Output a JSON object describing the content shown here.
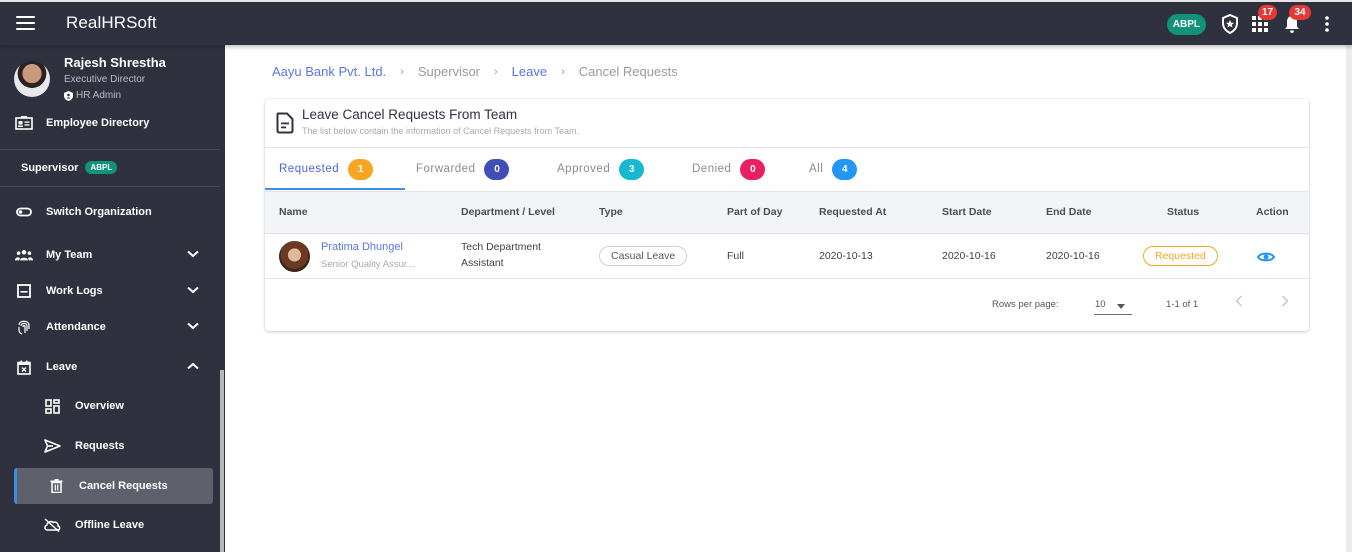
{
  "topbar": {
    "app_title": "RealHRSoft",
    "org_chip": "ABPL",
    "icons": [
      "menu-icon",
      "shield-star-icon",
      "apps-grid-icon",
      "bell-icon",
      "more-vert-icon"
    ],
    "apps_badge": "17",
    "notifications_badge": "34"
  },
  "sidebar": {
    "profile": {
      "name": "Rajesh Shrestha",
      "role": "Executive Director",
      "admin": "HR Admin"
    },
    "employee_directory": "Employee Directory",
    "section": {
      "label": "Supervisor",
      "chip": "ABPL"
    },
    "items": [
      {
        "label": "Switch Organization",
        "icon": "toggle-icon"
      },
      {
        "label": "My Team",
        "icon": "group-icon",
        "expand": "chevron-down"
      },
      {
        "label": "Work Logs",
        "icon": "worklog-icon",
        "expand": "chevron-down"
      },
      {
        "label": "Attendance",
        "icon": "fingerprint-icon",
        "expand": "chevron-down"
      },
      {
        "label": "Leave",
        "icon": "calendar-x-icon",
        "expand": "chevron-up"
      }
    ],
    "leave_sub": [
      {
        "label": "Overview",
        "icon": "dashboard-icon"
      },
      {
        "label": "Requests",
        "icon": "send-icon"
      },
      {
        "label": "Cancel Requests",
        "icon": "trash-icon",
        "active": true
      },
      {
        "label": "Offline Leave",
        "icon": "cloud-off-icon"
      }
    ]
  },
  "breadcrumb": {
    "items": [
      "Aayu Bank Pvt. Ltd.",
      "Supervisor",
      "Leave",
      "Cancel Requests"
    ],
    "separator": "›"
  },
  "card": {
    "title": "Leave Cancel Requests From Team",
    "subtitle": "The list below contain the information of Cancel Requests from Team.",
    "tabs": [
      {
        "label": "Requested",
        "count": "1",
        "color": "#f5a623",
        "active": true
      },
      {
        "label": "Forwarded",
        "count": "0",
        "color": "#3f4fb5"
      },
      {
        "label": "Approved",
        "count": "3",
        "color": "#17b9d0"
      },
      {
        "label": "Denied",
        "count": "0",
        "color": "#e91e63"
      },
      {
        "label": "All",
        "count": "4",
        "color": "#2196f3"
      }
    ],
    "columns": [
      "Name",
      "Department / Level",
      "Type",
      "Part of Day",
      "Requested At",
      "Start Date",
      "End Date",
      "Status",
      "Action"
    ],
    "rows": [
      {
        "name": "Pratima Dhungel",
        "title": "Senior Quality Assur...",
        "department": "Tech Department",
        "level": "Assistant",
        "type": "Casual Leave",
        "part_of_day": "Full",
        "requested_at": "2020-10-13",
        "start_date": "2020-10-16",
        "end_date": "2020-10-16",
        "status": "Requested",
        "status_color": "#f5a623",
        "action_icon": "eye-icon"
      }
    ],
    "pagination": {
      "rows_per_page_label": "Rows per page:",
      "rows_per_page": "10",
      "range": "1-1 of 1"
    }
  },
  "colors": {
    "sidebar_bg": "#30313f",
    "accent": "#3c8fe6",
    "link": "#5b75e6",
    "org_chip": "#11937a"
  }
}
